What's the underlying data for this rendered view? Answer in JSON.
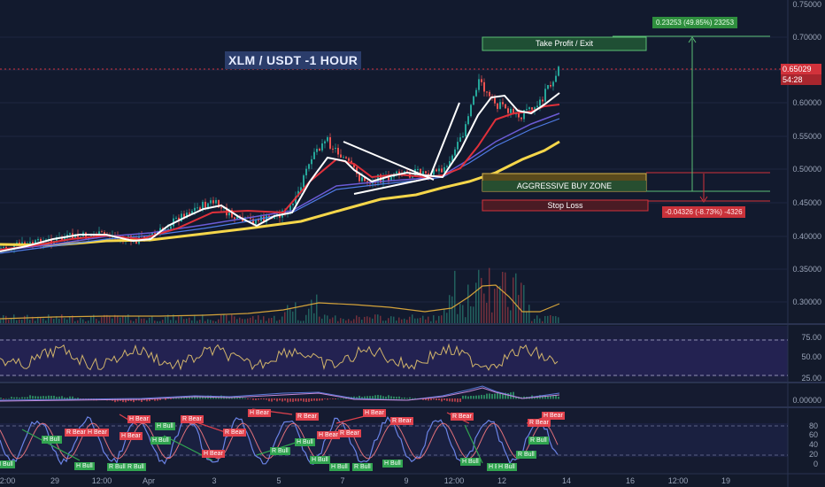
{
  "chart_title": "XLM / USDT -1 HOUR",
  "price_axis": [
    "0.75000",
    "0.70000",
    "0.65000",
    "0.60000",
    "0.55000",
    "0.50000",
    "0.45000",
    "0.40000",
    "0.35000",
    "0.30000"
  ],
  "current_price": {
    "value": "0.65029",
    "countdown": "54:28"
  },
  "rsi_axis": [
    "75.00",
    "50.00",
    "25.00"
  ],
  "macd_axis": [
    "0.00000"
  ],
  "stoch_axis": [
    "80",
    "60",
    "40",
    "20",
    "0"
  ],
  "time_axis": [
    "12:00",
    "29",
    "12:00",
    "Apr",
    "3",
    "5",
    "7",
    "9",
    "12:00",
    "12",
    "14",
    "16",
    "12:00",
    "19"
  ],
  "zones": {
    "take_profit": "Take Profit / Exit",
    "buy_zone": "AGGRESSIVE BUY ZONE",
    "stop_loss": "Stop Loss"
  },
  "measure": {
    "profit": "0.23253 (49.85%) 23253",
    "loss": "-0.04326 (-8.73%) -4326"
  },
  "osc_tags": [
    {
      "text": "H Bull",
      "type": "bull"
    },
    {
      "text": "H Bull",
      "type": "bull"
    },
    {
      "text": "H Bull",
      "type": "bull"
    },
    {
      "text": "R Bull",
      "type": "bull"
    },
    {
      "text": "R Bull",
      "type": "bull"
    },
    {
      "text": "R Bear",
      "type": "bear"
    },
    {
      "text": "H Bear",
      "type": "bear"
    },
    {
      "text": "H Bear",
      "type": "bear"
    },
    {
      "text": "H Bear",
      "type": "bear"
    },
    {
      "text": "H Bull",
      "type": "bull"
    },
    {
      "text": "H Bull",
      "type": "bull"
    },
    {
      "text": "R Bear",
      "type": "bear"
    },
    {
      "text": "R Bear",
      "type": "bear"
    },
    {
      "text": "H Bear",
      "type": "bear"
    },
    {
      "text": "H Bear",
      "type": "bear"
    },
    {
      "text": "R Bull",
      "type": "bull"
    },
    {
      "text": "H Bull",
      "type": "bull"
    },
    {
      "text": "R Bear",
      "type": "bear"
    },
    {
      "text": "R Bear",
      "type": "bear"
    },
    {
      "text": "H Bull",
      "type": "bull"
    },
    {
      "text": "H Bear",
      "type": "bear"
    },
    {
      "text": "H Bull",
      "type": "bull"
    },
    {
      "text": "R Bull",
      "type": "bull"
    },
    {
      "text": "H Bear",
      "type": "bear"
    },
    {
      "text": "R Bear",
      "type": "bear"
    },
    {
      "text": "H Bull",
      "type": "bull"
    },
    {
      "text": "R Bear",
      "type": "bear"
    },
    {
      "text": "H Bull",
      "type": "bull"
    },
    {
      "text": "H Bull",
      "type": "bull"
    },
    {
      "text": "R Bear",
      "type": "bear"
    },
    {
      "text": "R Bull",
      "type": "bull"
    },
    {
      "text": "H Bear",
      "type": "bear"
    },
    {
      "text": "R Bull",
      "type": "bull"
    },
    {
      "text": "H Bull",
      "type": "bull"
    }
  ],
  "colors": {
    "background": "#131a2b",
    "ema_white": "#ffffff",
    "ema_red": "#e0303a",
    "ema_yellow": "#f5d64a",
    "ema_purple": "#6b5bd6",
    "bull": "#31a450",
    "bear": "#e0424d"
  }
}
